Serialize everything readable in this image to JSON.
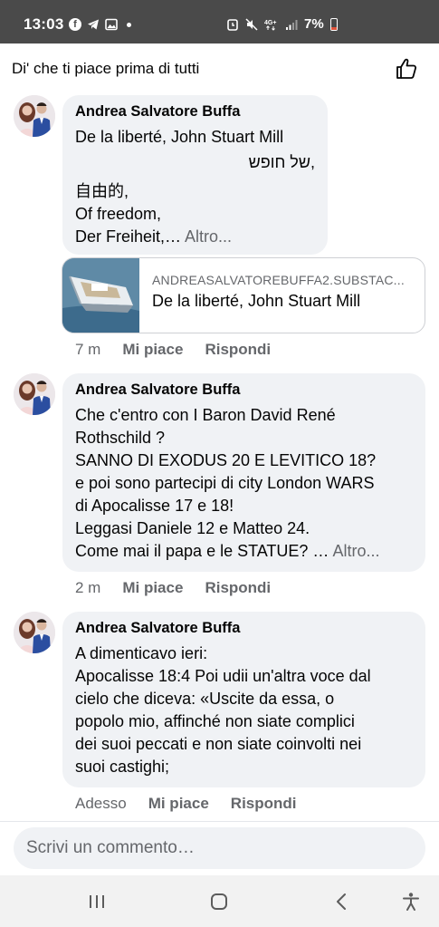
{
  "status_bar": {
    "time": "13:03",
    "battery": "7%",
    "left_icons": [
      "facebook-icon",
      "telegram-icon",
      "gallery-icon",
      "notification-dot"
    ],
    "right_icons": [
      "alarm-icon",
      "mute-icon",
      "4g-data-icon",
      "signal-icon",
      "battery-icon"
    ]
  },
  "header": {
    "like_first_text": "Di' che ti piace prima di tutti",
    "thumb_icon": "thumbs-up-icon"
  },
  "comments": [
    {
      "author": "Andrea Salvatore Buffa",
      "lines": [
        "De la liberté, John Stuart Mill",
        "של חופש,",
        "自由的,",
        "Of freedom,",
        "Der Freiheit,…"
      ],
      "more": "Altro...",
      "link": {
        "domain": "ANDREASALVATOREBUFFA2.SUBSTAC...",
        "title": "De la liberté, John Stuart Mill"
      },
      "time": "7 m",
      "like": "Mi piace",
      "reply": "Rispondi"
    },
    {
      "author": "Andrea Salvatore Buffa",
      "lines": [
        "Che c'entro con I Baron David René",
        "Rothschild ?",
        "SANNO DI EXODUS 20 E LEVITICO 18?",
        "e poi sono partecipi di city London WARS",
        "di Apocalisse 17 e 18!",
        "Leggasi Daniele 12 e Matteo 24.",
        "Come mai il papa e le STATUE? …"
      ],
      "more": "Altro...",
      "time": "2 m",
      "like": "Mi piace",
      "reply": "Rispondi"
    },
    {
      "author": "Andrea Salvatore Buffa",
      "lines": [
        "A dimenticavo ieri:",
        "Apocalisse 18:4  Poi udii un'altra voce dal",
        "cielo che diceva: «Uscite da essa, o",
        "popolo mio, affinché non siate complici",
        "dei suoi peccati e non siate coinvolti nei",
        "suoi castighi;"
      ],
      "time": "Adesso",
      "like": "Mi piace",
      "reply": "Rispondi"
    }
  ],
  "composer": {
    "placeholder": "Scrivi un commento…"
  },
  "nav_bar": {
    "icons": [
      "recent-apps-icon",
      "home-icon",
      "back-icon",
      "accessibility-icon"
    ]
  },
  "colors": {
    "status_bar_bg": "#4a4a4a",
    "bubble_bg": "#f0f2f5",
    "secondary_text": "#65676b",
    "primary_text": "#050505",
    "battery_low": "#e0533b"
  }
}
